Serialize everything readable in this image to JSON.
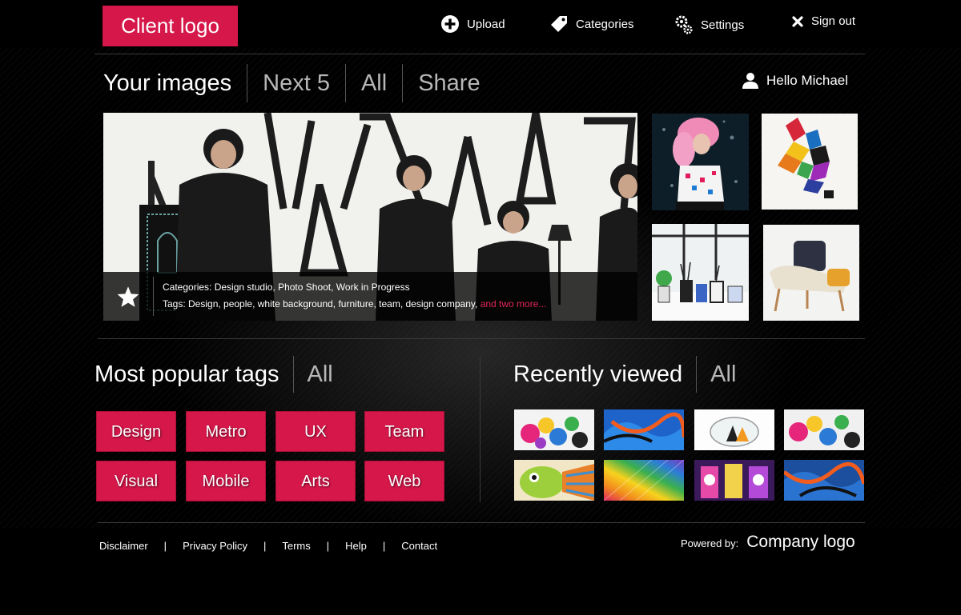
{
  "header": {
    "client_logo": "Client logo",
    "nav": [
      {
        "label": "Upload",
        "icon": "plus-circle-icon"
      },
      {
        "label": "Categories",
        "icon": "tag-icon"
      },
      {
        "label": "Settings",
        "icon": "gears-icon"
      },
      {
        "label": "Sign out",
        "icon": "close-icon"
      }
    ]
  },
  "gallery": {
    "tabs": [
      "Your images",
      "Next 5",
      "All",
      "Share"
    ],
    "greeting": "Hello Michael",
    "featured": {
      "categories": "Categories: Design studio, Photo Shoot, Work in Progress",
      "tags": "Tags: Design, people, white background, furniture, team, design company,",
      "more": "and two more..."
    }
  },
  "popular_tags": {
    "title": "Most popular tags",
    "all": "All",
    "tags": [
      "Design",
      "Metro",
      "UX",
      "Team",
      "Visual",
      "Mobile",
      "Arts",
      "Web"
    ]
  },
  "recently_viewed": {
    "title": "Recently viewed",
    "all": "All"
  },
  "footer": {
    "links": [
      "Disclaimer",
      "Privacy Policy",
      "Terms",
      "Help",
      "Contact"
    ],
    "powered_label": "Powered by:",
    "company_logo": "Company logo"
  },
  "colors": {
    "accent": "#d5174a",
    "background": "#000000",
    "muted_text": "#b7b7b7"
  }
}
